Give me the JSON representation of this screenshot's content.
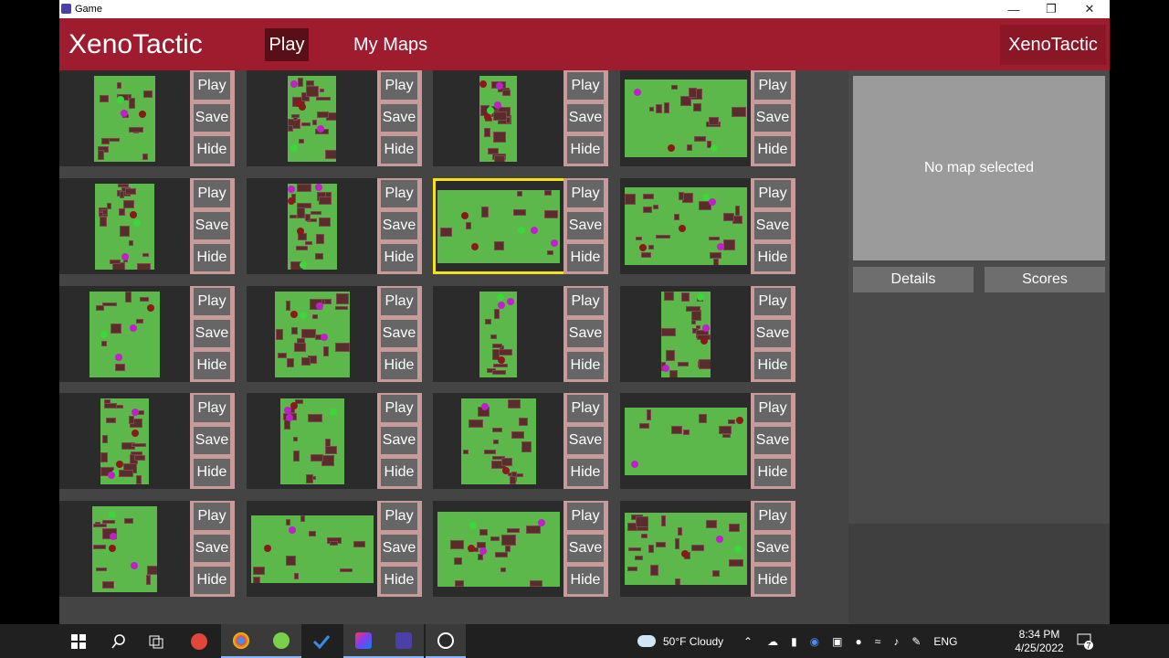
{
  "window": {
    "title": "Game"
  },
  "header": {
    "brand": "XenoTactic",
    "nav_play": "Play",
    "nav_my_maps": "My Maps",
    "brand_right": "XenoTactic"
  },
  "map_buttons": {
    "play": "Play",
    "save": "Save",
    "hide": "Hide"
  },
  "maps": [
    {
      "row": 0,
      "col": 0,
      "shape": "portrait",
      "selected": false
    },
    {
      "row": 0,
      "col": 1,
      "shape": "portrait",
      "selected": false
    },
    {
      "row": 0,
      "col": 2,
      "shape": "portrait",
      "selected": false
    },
    {
      "row": 0,
      "col": 3,
      "shape": "landscape",
      "selected": false
    },
    {
      "row": 1,
      "col": 0,
      "shape": "portrait",
      "selected": false
    },
    {
      "row": 1,
      "col": 1,
      "shape": "portrait",
      "selected": false
    },
    {
      "row": 1,
      "col": 2,
      "shape": "landscape",
      "selected": true
    },
    {
      "row": 1,
      "col": 3,
      "shape": "landscape",
      "selected": false
    },
    {
      "row": 2,
      "col": 0,
      "shape": "portrait",
      "selected": false
    },
    {
      "row": 2,
      "col": 1,
      "shape": "portrait",
      "selected": false
    },
    {
      "row": 2,
      "col": 2,
      "shape": "portrait",
      "selected": false
    },
    {
      "row": 2,
      "col": 3,
      "shape": "portrait",
      "selected": false
    },
    {
      "row": 3,
      "col": 0,
      "shape": "portrait",
      "selected": false
    },
    {
      "row": 3,
      "col": 1,
      "shape": "portrait",
      "selected": false
    },
    {
      "row": 3,
      "col": 2,
      "shape": "portrait",
      "selected": false
    },
    {
      "row": 3,
      "col": 3,
      "shape": "landscape",
      "selected": false
    },
    {
      "row": 4,
      "col": 0,
      "shape": "portrait",
      "selected": false
    },
    {
      "row": 4,
      "col": 1,
      "shape": "landscape",
      "selected": false
    },
    {
      "row": 4,
      "col": 2,
      "shape": "landscape",
      "selected": false
    },
    {
      "row": 4,
      "col": 3,
      "shape": "landscape",
      "selected": false
    }
  ],
  "sidebar": {
    "preview_text": "No map selected",
    "details_label": "Details",
    "scores_label": "Scores"
  },
  "taskbar": {
    "apps": [
      "start-icon",
      "search-icon",
      "task-view-icon",
      "snip-icon",
      "chrome-icon",
      "clover-icon",
      "todo-icon",
      "intellij-icon",
      "game-icon",
      "obs-icon"
    ],
    "weather": "50°F  Cloudy",
    "language": "ENG",
    "time": "8:34 PM",
    "date": "4/25/2022",
    "notifications": "7"
  },
  "colors": {
    "header": "#9e1c2e",
    "map_floor": "#5cb84a",
    "wall": "#5a2c2c",
    "selection": "#f5e21a",
    "button_column": "#c99a9a"
  }
}
